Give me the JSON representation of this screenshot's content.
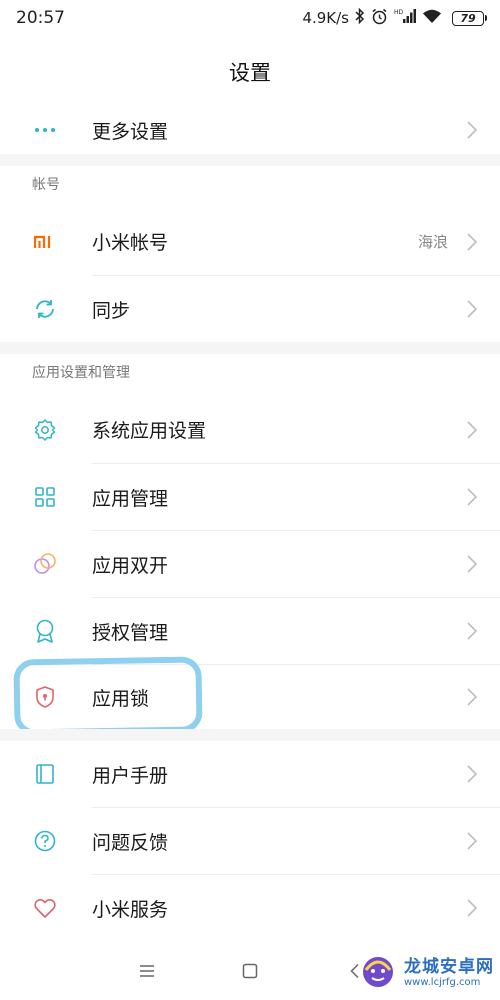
{
  "status_bar": {
    "time": "20:57",
    "speed": "4.9K/s",
    "bluetooth_icon": "bluetooth-icon",
    "alarm_icon": "alarm-icon",
    "network": "HD",
    "wifi_icon": "wifi-icon",
    "battery": "79"
  },
  "header": {
    "title": "设置"
  },
  "top_item": {
    "label": "更多设置",
    "icon": "more-dots-icon"
  },
  "sections": {
    "account": {
      "title": "帐号",
      "items": [
        {
          "label": "小米帐号",
          "value": "海浪",
          "icon": "mi-logo-icon",
          "icon_text": "MI"
        },
        {
          "label": "同步",
          "value": "",
          "icon": "sync-icon"
        }
      ]
    },
    "apps": {
      "title": "应用设置和管理",
      "items": [
        {
          "label": "系统应用设置",
          "icon": "gear-icon"
        },
        {
          "label": "应用管理",
          "icon": "grid-icon"
        },
        {
          "label": "应用双开",
          "icon": "dual-circles-icon"
        },
        {
          "label": "授权管理",
          "icon": "badge-icon"
        },
        {
          "label": "应用锁",
          "icon": "shield-lock-icon"
        }
      ]
    },
    "misc": {
      "items": [
        {
          "label": "用户手册",
          "icon": "book-icon"
        },
        {
          "label": "问题反馈",
          "icon": "question-icon"
        },
        {
          "label": "小米服务",
          "icon": "heart-icon"
        }
      ]
    }
  },
  "nav": {
    "menu_icon": "menu-icon",
    "home_icon": "home-square-icon",
    "back_icon": "back-icon"
  },
  "watermark": {
    "title": "龙城安卓网",
    "url": "www.lcjrfg.com"
  },
  "colors": {
    "accent": "#2fb4cc",
    "mi_orange": "#ff6a00",
    "highlight": "#8fd0ee",
    "separator": "#f5f5f5"
  }
}
